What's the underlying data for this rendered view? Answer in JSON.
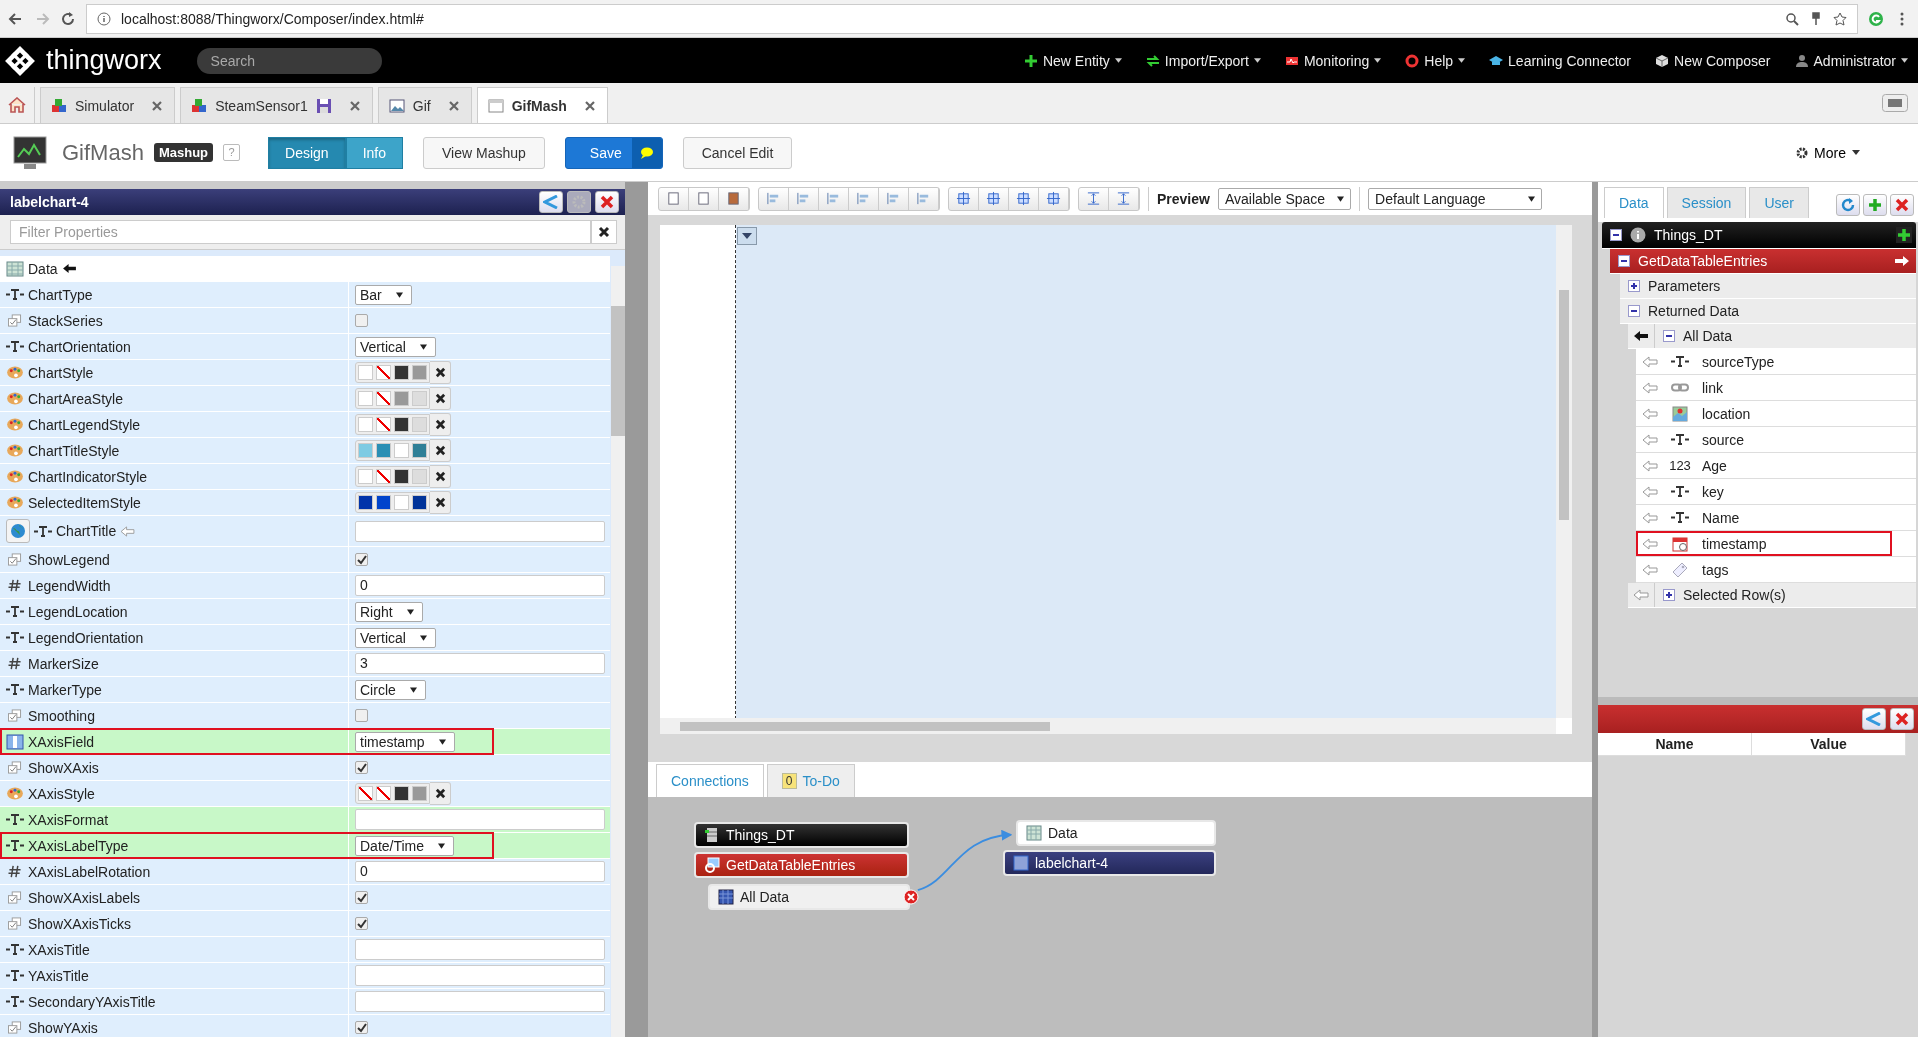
{
  "browser": {
    "address": "localhost:8088/Thingworx/Composer/index.html#"
  },
  "nav": {
    "logo": "thingworx",
    "search_placeholder": "Search",
    "menus": [
      {
        "label": "New Entity",
        "kind": "plus",
        "caret": true
      },
      {
        "label": "Import/Export",
        "kind": "arrows",
        "caret": true
      },
      {
        "label": "Monitoring",
        "kind": "monitor",
        "caret": true
      },
      {
        "label": "Help",
        "kind": "lifebuoy",
        "caret": true
      },
      {
        "label": "Learning Connector",
        "kind": "cap",
        "caret": false
      },
      {
        "label": "New Composer",
        "kind": "cube",
        "caret": false
      },
      {
        "label": "Administrator",
        "kind": "user",
        "caret": true
      }
    ]
  },
  "tabs": [
    {
      "label": "Simulator",
      "kind": "thing",
      "selected": false,
      "unsaved": false
    },
    {
      "label": "SteamSensor1",
      "kind": "thing",
      "selected": false,
      "unsaved": true
    },
    {
      "label": "Gif",
      "kind": "image",
      "selected": false,
      "unsaved": false
    },
    {
      "label": "GifMash",
      "kind": "page",
      "selected": true,
      "unsaved": false
    }
  ],
  "toolbar": {
    "title": "GifMash",
    "badge": "Mashup",
    "help": "?",
    "modes": [
      {
        "label": "Design",
        "selected": true
      },
      {
        "label": "Info",
        "selected": false
      }
    ],
    "buttons": [
      {
        "label": "View Mashup",
        "kind": "plain"
      },
      {
        "label": "Save",
        "kind": "primary"
      },
      {
        "label": "Cancel Edit",
        "kind": "plain"
      }
    ],
    "more": "More"
  },
  "properties": {
    "title": "labelchart-4",
    "filter_placeholder": "Filter Properties",
    "rows": [
      {
        "label": "Data",
        "kind": "table",
        "highlighted": false,
        "outlined": false
      },
      {
        "label": "ChartType",
        "kind": "textselect",
        "value": "Bar",
        "highlighted": false,
        "outlined": false
      },
      {
        "label": "StackSeries",
        "kind": "checkbox",
        "checked": false,
        "highlighted": false,
        "outlined": false
      },
      {
        "label": "ChartOrientation",
        "kind": "textselect",
        "value": "Vertical",
        "highlighted": false,
        "outlined": false
      },
      {
        "label": "ChartStyle",
        "kind": "style",
        "highlighted": false,
        "outlined": false
      },
      {
        "label": "ChartAreaStyle",
        "kind": "style",
        "highlighted": false,
        "outlined": false
      },
      {
        "label": "ChartLegendStyle",
        "kind": "style",
        "highlighted": false,
        "outlined": false
      },
      {
        "label": "ChartTitleStyle",
        "kind": "style",
        "highlighted": false,
        "outlined": false
      },
      {
        "label": "ChartIndicatorStyle",
        "kind": "style",
        "highlighted": false,
        "outlined": false
      },
      {
        "label": "SelectedItemStyle",
        "kind": "style",
        "highlighted": false,
        "outlined": false
      },
      {
        "label": "ChartTitle",
        "kind": "localtext",
        "highlighted": false,
        "outlined": false
      },
      {
        "label": "ShowLegend",
        "kind": "checkbox",
        "checked": true,
        "highlighted": false,
        "outlined": false
      },
      {
        "label": "LegendWidth",
        "kind": "numberinput",
        "value": "0",
        "highlighted": false,
        "outlined": false
      },
      {
        "label": "LegendLocation",
        "kind": "textselect",
        "value": "Right",
        "highlighted": false,
        "outlined": false
      },
      {
        "label": "LegendOrientation",
        "kind": "textselect",
        "value": "Vertical",
        "highlighted": false,
        "outlined": false
      },
      {
        "label": "MarkerSize",
        "kind": "numberinput",
        "value": "3",
        "highlighted": false,
        "outlined": false
      },
      {
        "label": "MarkerType",
        "kind": "textselect",
        "value": "Circle",
        "highlighted": false,
        "outlined": false
      },
      {
        "label": "Smoothing",
        "kind": "checkbox",
        "checked": false,
        "highlighted": false,
        "outlined": false
      },
      {
        "label": "XAxisField",
        "kind": "fieldselect",
        "value": "timestamp",
        "highlighted": true,
        "outlined": true
      },
      {
        "label": "ShowXAxis",
        "kind": "checkbox",
        "checked": true,
        "highlighted": false,
        "outlined": false
      },
      {
        "label": "XAxisStyle",
        "kind": "style",
        "highlighted": false,
        "outlined": false
      },
      {
        "label": "XAxisFormat",
        "kind": "textinput",
        "highlighted": true,
        "outlined": false
      },
      {
        "label": "XAxisLabelType",
        "kind": "textselect",
        "value": "Date/Time",
        "highlighted": true,
        "outlined": true
      },
      {
        "label": "XAxisLabelRotation",
        "kind": "numberinput",
        "value": "0",
        "highlighted": false,
        "outlined": false
      },
      {
        "label": "ShowXAxisLabels",
        "kind": "checkbox",
        "checked": true,
        "highlighted": false,
        "outlined": false
      },
      {
        "label": "ShowXAxisTicks",
        "kind": "checkbox",
        "checked": true,
        "highlighted": false,
        "outlined": false
      },
      {
        "label": "XAxisTitle",
        "kind": "textinput",
        "highlighted": false,
        "outlined": false
      },
      {
        "label": "YAxisTitle",
        "kind": "textinput",
        "highlighted": false,
        "outlined": false
      },
      {
        "label": "SecondaryYAxisTitle",
        "kind": "textinput",
        "highlighted": false,
        "outlined": false
      },
      {
        "label": "ShowYAxis",
        "kind": "checkbox",
        "checked": true,
        "highlighted": false,
        "outlined": false
      }
    ]
  },
  "designer": {
    "preview_label": "Preview",
    "preview_select": "Available Space",
    "language_select": "Default Language"
  },
  "bottom_tabs": [
    {
      "label": "Connections",
      "selected": true
    },
    {
      "label": "To-Do",
      "selected": false,
      "count": "0"
    }
  ],
  "connections": {
    "sources": [
      {
        "label": "Things_DT",
        "kind": "thing"
      },
      {
        "label": "GetDataTableEntries",
        "kind": "service"
      },
      {
        "label": "All Data",
        "kind": "output"
      }
    ],
    "targets": [
      {
        "label": "Data",
        "kind": "property"
      },
      {
        "label": "labelchart-4",
        "kind": "widget"
      }
    ]
  },
  "data_panel": {
    "tabs": [
      {
        "label": "Data",
        "selected": true
      },
      {
        "label": "Session",
        "selected": false
      },
      {
        "label": "User",
        "selected": false
      }
    ],
    "tree": {
      "label": "Things_DT",
      "expanded": true,
      "children": [
        {
          "label": "GetDataTableEntries",
          "expanded": true,
          "children": [
            {
              "label": "Parameters",
              "expanded": false
            },
            {
              "label": "Returned Data",
              "expanded": true,
              "children": [
                {
                  "label": "All Data",
                  "expanded": true,
                  "bound": true,
                  "children": [
                    {
                      "label": "sourceType",
                      "kind": "string",
                      "outlined": false
                    },
                    {
                      "label": "link",
                      "kind": "link",
                      "outlined": false
                    },
                    {
                      "label": "location",
                      "kind": "location",
                      "outlined": false
                    },
                    {
                      "label": "source",
                      "kind": "string",
                      "outlined": false
                    },
                    {
                      "label": "Age",
                      "kind": "number",
                      "glyph": "123",
                      "outlined": false
                    },
                    {
                      "label": "key",
                      "kind": "string",
                      "outlined": false
                    },
                    {
                      "label": "Name",
                      "kind": "string",
                      "outlined": false
                    },
                    {
                      "label": "timestamp",
                      "kind": "datetime",
                      "outlined": true
                    },
                    {
                      "label": "tags",
                      "kind": "tags",
                      "outlined": false
                    }
                  ]
                },
                {
                  "label": "Selected Row(s)",
                  "expanded": false,
                  "bound": false
                }
              ]
            }
          ]
        }
      ]
    }
  },
  "details": {
    "columns": [
      "Name",
      "Value"
    ]
  }
}
